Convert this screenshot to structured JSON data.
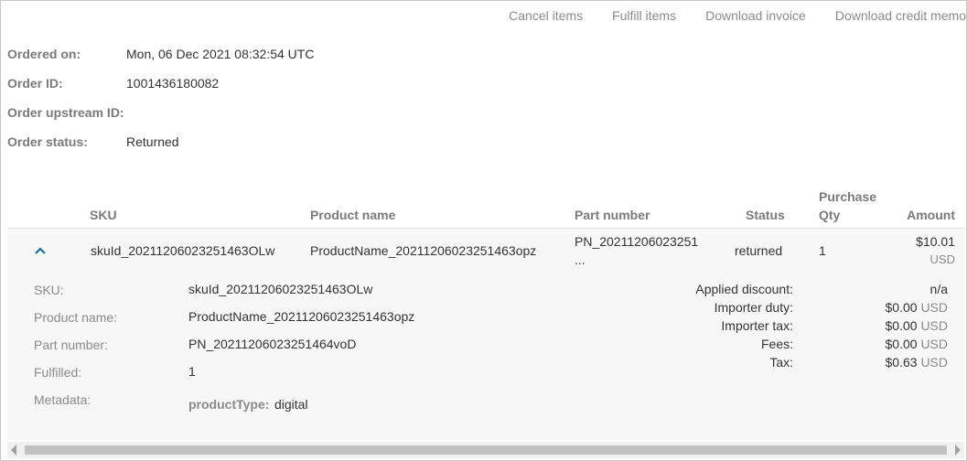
{
  "actions": {
    "cancel": "Cancel items",
    "fulfill": "Fulfill items",
    "invoice": "Download invoice",
    "credit_memo": "Download credit memo"
  },
  "order": {
    "ordered_on_label": "Ordered on:",
    "ordered_on": "Mon, 06 Dec 2021 08:32:54 UTC",
    "order_id_label": "Order ID:",
    "order_id": "1001436180082",
    "upstream_label": "Order upstream ID:",
    "upstream_id": "",
    "status_label": "Order status:",
    "status": "Returned"
  },
  "table": {
    "headers": {
      "sku": "SKU",
      "product_name": "Product name",
      "part_number": "Part number",
      "status": "Status",
      "qty_line1": "Purchase",
      "qty_line2": "Qty",
      "amount": "Amount"
    },
    "row": {
      "expand_icon": "chevron-up-icon",
      "sku": "skuId_20211206023251463OLw",
      "product_name": "ProductName_20211206023251463opz",
      "part_number": "PN_20211206023251",
      "part_number_more": "...",
      "status": "returned",
      "qty": "1",
      "amount": "$10.01",
      "currency": "USD"
    }
  },
  "details": {
    "sku_label": "SKU:",
    "sku": "skuId_20211206023251463OLw",
    "product_name_label": "Product name:",
    "product_name": "ProductName_20211206023251463opz",
    "part_number_label": "Part number:",
    "part_number": "PN_20211206023251464voD",
    "fulfilled_label": "Fulfilled:",
    "fulfilled": "1",
    "metadata_label": "Metadata:",
    "metadata_key": "productType:",
    "metadata_value": "digital",
    "applied_discount_label": "Applied discount:",
    "applied_discount": "n/a",
    "importer_duty_label": "Importer duty:",
    "importer_duty": "$0.00",
    "importer_tax_label": "Importer tax:",
    "importer_tax": "$0.00",
    "fees_label": "Fees:",
    "fees": "$0.00",
    "tax_label": "Tax:",
    "tax": "$0.63",
    "currency": "USD"
  }
}
